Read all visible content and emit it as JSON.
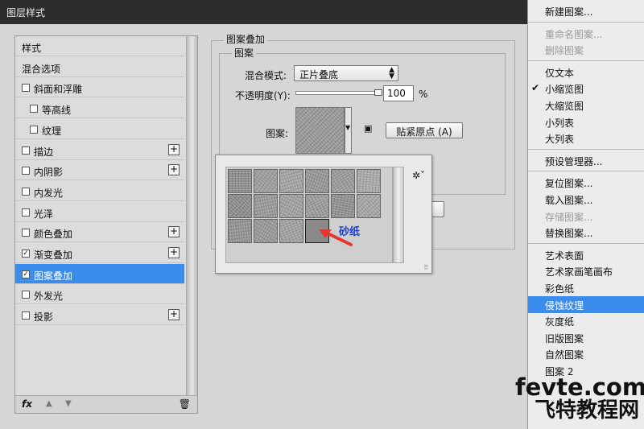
{
  "window": {
    "title": "图层样式"
  },
  "styles_panel": {
    "items": [
      {
        "label": "样式",
        "checkbox": false,
        "checked": false,
        "indent": 0,
        "plus": false,
        "selected": false
      },
      {
        "label": "混合选项",
        "checkbox": false,
        "checked": false,
        "indent": 0,
        "plus": false,
        "selected": false
      },
      {
        "label": "斜面和浮雕",
        "checkbox": true,
        "checked": false,
        "indent": 0,
        "plus": false,
        "selected": false
      },
      {
        "label": "等高线",
        "checkbox": true,
        "checked": false,
        "indent": 1,
        "plus": false,
        "selected": false
      },
      {
        "label": "纹理",
        "checkbox": true,
        "checked": false,
        "indent": 1,
        "plus": false,
        "selected": false
      },
      {
        "label": "描边",
        "checkbox": true,
        "checked": false,
        "indent": 0,
        "plus": true,
        "selected": false
      },
      {
        "label": "内阴影",
        "checkbox": true,
        "checked": false,
        "indent": 0,
        "plus": true,
        "selected": false
      },
      {
        "label": "内发光",
        "checkbox": true,
        "checked": false,
        "indent": 0,
        "plus": false,
        "selected": false
      },
      {
        "label": "光泽",
        "checkbox": true,
        "checked": false,
        "indent": 0,
        "plus": false,
        "selected": false
      },
      {
        "label": "颜色叠加",
        "checkbox": true,
        "checked": false,
        "indent": 0,
        "plus": true,
        "selected": false
      },
      {
        "label": "渐变叠加",
        "checkbox": true,
        "checked": true,
        "indent": 0,
        "plus": true,
        "selected": false
      },
      {
        "label": "图案叠加",
        "checkbox": true,
        "checked": true,
        "indent": 0,
        "plus": false,
        "selected": true
      },
      {
        "label": "外发光",
        "checkbox": true,
        "checked": false,
        "indent": 0,
        "plus": false,
        "selected": false
      },
      {
        "label": "投影",
        "checkbox": true,
        "checked": false,
        "indent": 0,
        "plus": true,
        "selected": false
      }
    ],
    "fx_label": "fx"
  },
  "settings": {
    "group_title": "图案叠加",
    "sub_group_title": "图案",
    "blend_mode_label": "混合模式:",
    "blend_mode_value": "正片叠底",
    "opacity_label": "不透明度(Y):",
    "opacity_value": "100",
    "opacity_unit": "%",
    "opacity_level": 1.0,
    "pattern_label": "图案:",
    "snap_button": "贴紧原点 (A)"
  },
  "picker": {
    "selected_label": "砂纸",
    "tile_count": 16,
    "selected_index": 15
  },
  "menu": {
    "items": [
      {
        "label": "新建图案...",
        "disabled": false,
        "checked": false,
        "highlight": false
      },
      {
        "sep": true
      },
      {
        "label": "重命名图案...",
        "disabled": true,
        "checked": false,
        "highlight": false
      },
      {
        "label": "删除图案",
        "disabled": true,
        "checked": false,
        "highlight": false
      },
      {
        "sep": true
      },
      {
        "label": "仅文本",
        "disabled": false,
        "checked": false,
        "highlight": false
      },
      {
        "label": "小缩览图",
        "disabled": false,
        "checked": true,
        "highlight": false
      },
      {
        "label": "大缩览图",
        "disabled": false,
        "checked": false,
        "highlight": false
      },
      {
        "label": "小列表",
        "disabled": false,
        "checked": false,
        "highlight": false
      },
      {
        "label": "大列表",
        "disabled": false,
        "checked": false,
        "highlight": false
      },
      {
        "sep": true
      },
      {
        "label": "预设管理器...",
        "disabled": false,
        "checked": false,
        "highlight": false
      },
      {
        "sep": true
      },
      {
        "label": "复位图案...",
        "disabled": false,
        "checked": false,
        "highlight": false
      },
      {
        "label": "载入图案...",
        "disabled": false,
        "checked": false,
        "highlight": false
      },
      {
        "label": "存储图案...",
        "disabled": true,
        "checked": false,
        "highlight": false
      },
      {
        "label": "替换图案...",
        "disabled": false,
        "checked": false,
        "highlight": false
      },
      {
        "sep": true
      },
      {
        "label": "艺术表面",
        "disabled": false,
        "checked": false,
        "highlight": false
      },
      {
        "label": "艺术家画笔画布",
        "disabled": false,
        "checked": false,
        "highlight": false
      },
      {
        "label": "彩色纸",
        "disabled": false,
        "checked": false,
        "highlight": false
      },
      {
        "label": "侵蚀纹理",
        "disabled": false,
        "checked": false,
        "highlight": true
      },
      {
        "label": "灰度纸",
        "disabled": false,
        "checked": false,
        "highlight": false
      },
      {
        "label": "旧版图案",
        "disabled": false,
        "checked": false,
        "highlight": false
      },
      {
        "label": "自然图案",
        "disabled": false,
        "checked": false,
        "highlight": false
      },
      {
        "label": "图案 2",
        "disabled": false,
        "checked": false,
        "highlight": false
      }
    ]
  },
  "watermark": {
    "line1": "fevte.com",
    "line2": "飞特教程网"
  },
  "colors": {
    "accent": "#3b8ded",
    "annotation": "#1d3fcc",
    "arrow": "#e8372c"
  }
}
